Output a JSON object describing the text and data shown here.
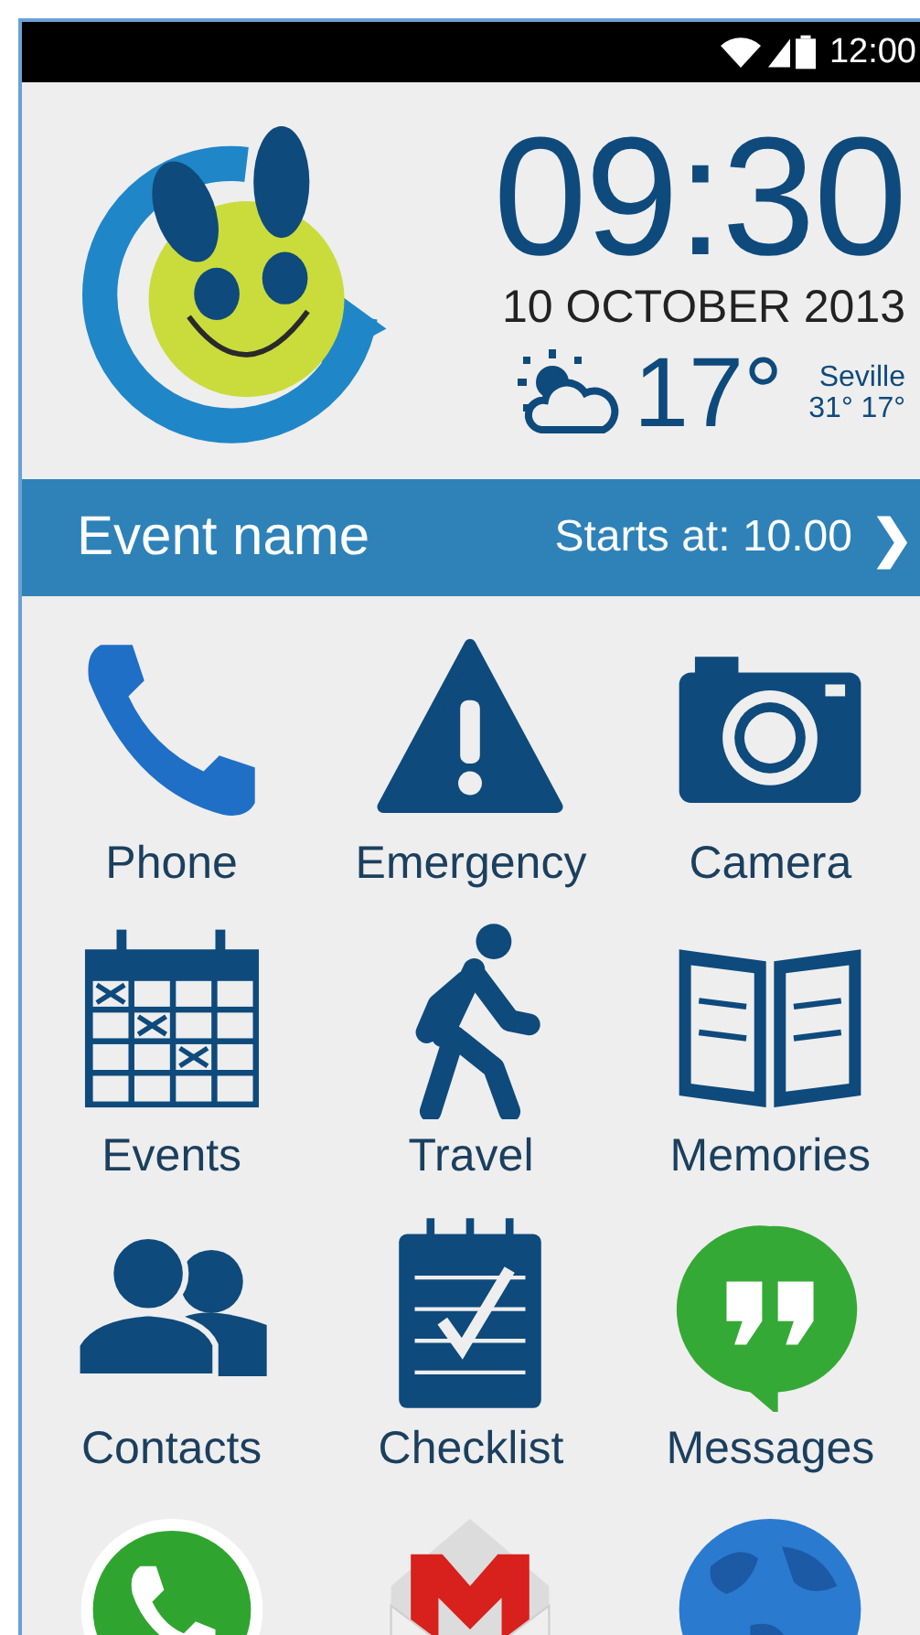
{
  "status_bar": {
    "time": "12:00"
  },
  "clock": {
    "time": "09:30",
    "date": "10 OCTOBER 2013"
  },
  "weather": {
    "temperature": "17°",
    "city": "Seville",
    "range": "31° 17°"
  },
  "event": {
    "name": "Event name",
    "start": "Starts at: 10.00",
    "chevron": "❯"
  },
  "apps": [
    {
      "kind": "phone",
      "label": "Phone"
    },
    {
      "kind": "emergency",
      "label": "Emergency"
    },
    {
      "kind": "camera",
      "label": "Camera"
    },
    {
      "kind": "events",
      "label": "Events"
    },
    {
      "kind": "travel",
      "label": "Travel"
    },
    {
      "kind": "memories",
      "label": "Memories"
    },
    {
      "kind": "contacts",
      "label": "Contacts"
    },
    {
      "kind": "checklist",
      "label": "Checklist"
    },
    {
      "kind": "messages",
      "label": "Messages"
    },
    {
      "kind": "whatsapp"
    },
    {
      "kind": "mail"
    },
    {
      "kind": "globe"
    }
  ]
}
